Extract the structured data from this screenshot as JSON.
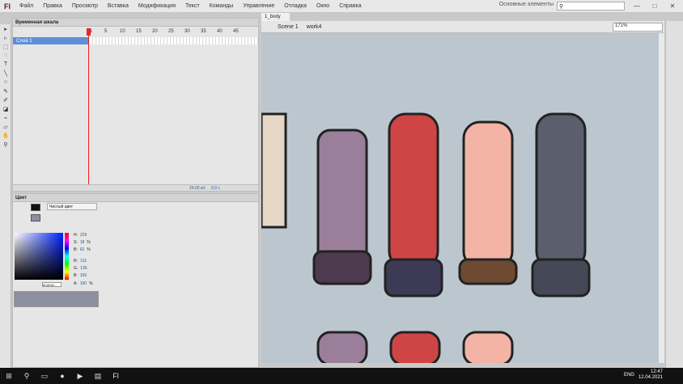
{
  "window": {
    "app_logo": "Fl",
    "menu": [
      "Файл",
      "Правка",
      "Просмотр",
      "Вставка",
      "Модификация",
      "Текст",
      "Команды",
      "Управление",
      "Отладка",
      "Окно",
      "Справка"
    ],
    "workspace": "Основные элементы",
    "controls": [
      "—",
      "□",
      "✕"
    ]
  },
  "timeline": {
    "title": "Временная шкала",
    "ruler": [
      "1",
      "5",
      "10",
      "15",
      "20",
      "25",
      "30",
      "35",
      "40",
      "45"
    ],
    "layer": "Слой 1",
    "fps": "24,00 к/с",
    "time": "0,0 с"
  },
  "document": {
    "tab": "1_body",
    "scene": "Scene 1",
    "symbol": "work4",
    "zoom": "171%"
  },
  "color_panel": {
    "title": "Цвет",
    "fill_type": "Чистый цвет",
    "fill_color": "#8C8FA0",
    "stroke_color": "#111111",
    "H_label": "H:",
    "H": "229",
    "S_label": "S:",
    "S": "18",
    "B_label": "B:",
    "B": "62",
    "R_label": "R:",
    "R": "131",
    "G_label": "G:",
    "G": "136",
    "B2_label": "B:",
    "B2": "159",
    "A_label": "A:",
    "A": "100",
    "hex": "8C8FA0",
    "pct": "%"
  },
  "taskbar": {
    "lang": "ENG",
    "time": "12:47",
    "date": "12.04.2021"
  }
}
